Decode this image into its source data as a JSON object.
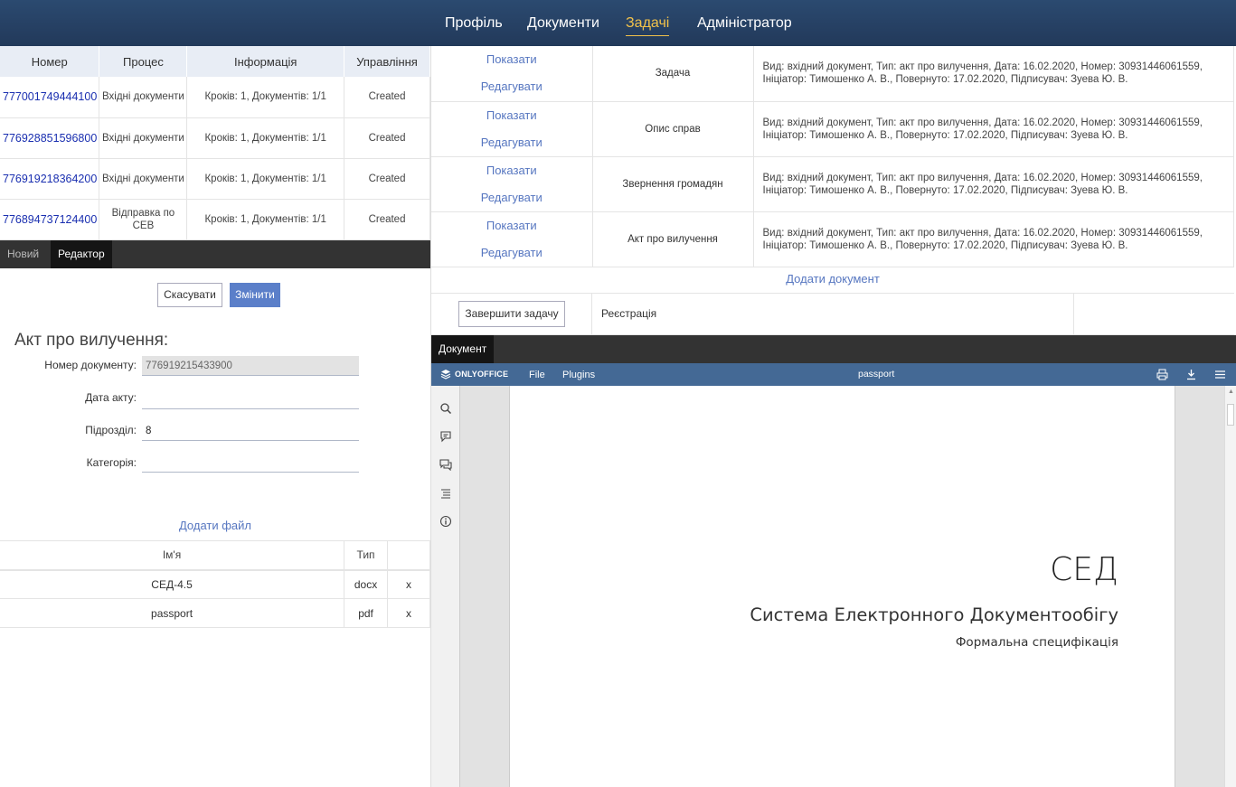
{
  "nav": {
    "items": [
      "Профіль",
      "Документи",
      "Задачі",
      "Адміністратор"
    ],
    "active": "Задачі"
  },
  "tasks_table": {
    "headers": [
      "Номер",
      "Процес",
      "Інформація",
      "Управління"
    ],
    "rows": [
      {
        "number": "777001749444100",
        "process": "Вхідні документи",
        "info": "Кроків: 1, Документів: 1/1",
        "status": "Created"
      },
      {
        "number": "776928851596800",
        "process": "Вхідні документи",
        "info": "Кроків: 1, Документів: 1/1",
        "status": "Created"
      },
      {
        "number": "776919218364200",
        "process": "Вхідні документи",
        "info": "Кроків: 1, Документів: 1/1",
        "status": "Created"
      },
      {
        "number": "776894737124400",
        "process": "Відправка по СЕВ",
        "info": "Кроків: 1, Документів: 1/1",
        "status": "Created"
      }
    ]
  },
  "editor_tabs": [
    "Новий",
    "Редактор"
  ],
  "form": {
    "cancel_label": "Скасувати",
    "submit_label": "Змінити",
    "title": "Акт про вилучення:",
    "fields": [
      {
        "label": "Номер документу:",
        "value": "776919215433900"
      },
      {
        "label": "Дата акту:",
        "value": ""
      },
      {
        "label": "Підрозділ:",
        "value": "8"
      },
      {
        "label": "Категорія:",
        "value": ""
      }
    ],
    "add_file_label": "Додати файл"
  },
  "files_table": {
    "headers": [
      "Ім'я",
      "Тип",
      ""
    ],
    "rows": [
      {
        "name": "СЕД-4.5",
        "type": "docx",
        "remove": "x"
      },
      {
        "name": "passport",
        "type": "pdf",
        "remove": "x"
      }
    ]
  },
  "documents_table": {
    "show_label": "Показати",
    "edit_label": "Редагувати",
    "rows": [
      {
        "type": "Задача",
        "info": "Вид: вхідний документ, Тип: акт про вилучення, Дата: 16.02.2020, Номер: 30931446061559, Ініціатор: Тимошенко А. В., Повернуто: 17.02.2020, Підписувач: Зуева Ю. В."
      },
      {
        "type": "Опис справ",
        "info": "Вид: вхідний документ, Тип: акт про вилучення, Дата: 16.02.2020, Номер: 30931446061559, Ініціатор: Тимошенко А. В., Повернуто: 17.02.2020, Підписувач: Зуева Ю. В."
      },
      {
        "type": "Звернення громадян",
        "info": "Вид: вхідний документ, Тип: акт про вилучення, Дата: 16.02.2020, Номер: 30931446061559, Ініціатор: Тимошенко А. В., Повернуто: 17.02.2020, Підписувач: Зуева Ю. В."
      },
      {
        "type": "Акт про вилучення",
        "info": "Вид: вхідний документ, Тип: акт про вилучення, Дата: 16.02.2020, Номер: 30931446061559, Ініціатор: Тимошенко А. В., Повернуто: 17.02.2020, Підписувач: Зуева Ю. В."
      }
    ],
    "add_document_label": "Додати документ",
    "finish_task_label": "Завершити задачу",
    "stage": "Реєстрація"
  },
  "document_tab": "Документ",
  "viewer": {
    "brand": "ONLYOFFICE",
    "menu": [
      "File",
      "Plugins"
    ],
    "filename": "passport",
    "page_title": "СЕД",
    "page_subtitle": "Система Електронного Документообігу",
    "page_caption": "Формальна специфікація"
  },
  "colors": {
    "nav_bg": "#22395a",
    "nav_active": "#f2c24a",
    "link": "#5676c0",
    "primary_button": "#5b7fc9",
    "viewer_header": "#446995"
  }
}
